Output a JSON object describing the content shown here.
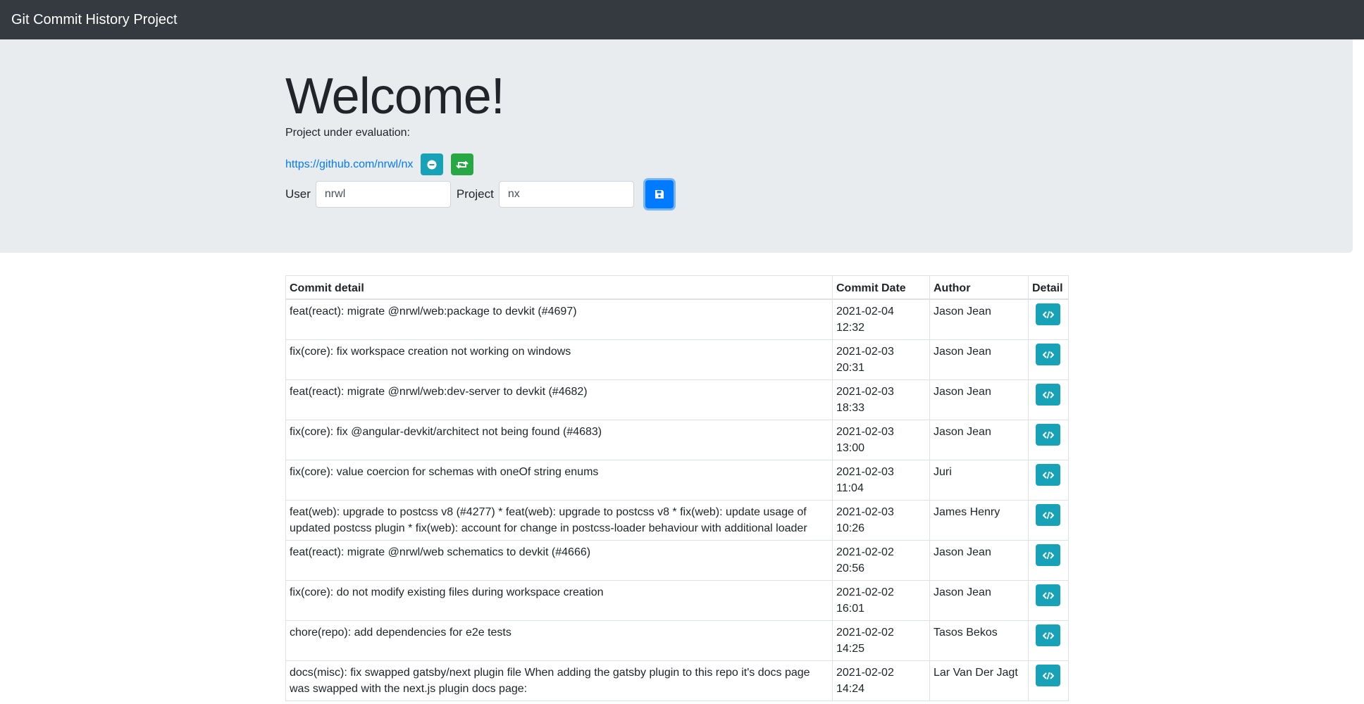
{
  "navbar": {
    "brand": "Git Commit History Project"
  },
  "jumbotron": {
    "title": "Welcome!",
    "eval_label": "Project under evaluation:",
    "repo_link": "https://github.com/nrwl/nx",
    "user_label": "User",
    "user_value": "nrwl",
    "project_label": "Project",
    "project_value": "nx"
  },
  "table": {
    "headers": {
      "detail": "Commit detail",
      "date": "Commit Date",
      "author": "Author",
      "btn": "Detail"
    },
    "rows": [
      {
        "detail": "feat(react): migrate @nrwl/web:package to devkit (#4697)",
        "date1": "2021-02-04",
        "date2": "12:32",
        "author": "Jason Jean"
      },
      {
        "detail": "fix(core): fix workspace creation not working on windows",
        "date1": "2021-02-03",
        "date2": "20:31",
        "author": "Jason Jean"
      },
      {
        "detail": "feat(react): migrate @nrwl/web:dev-server to devkit (#4682)",
        "date1": "2021-02-03",
        "date2": "18:33",
        "author": "Jason Jean"
      },
      {
        "detail": "fix(core): fix @angular-devkit/architect not being found (#4683)",
        "date1": "2021-02-03",
        "date2": "13:00",
        "author": "Jason Jean"
      },
      {
        "detail": "fix(core): value coercion for schemas with oneOf string enums",
        "date1": "2021-02-03",
        "date2": "11:04",
        "author": "Juri"
      },
      {
        "detail": "feat(web): upgrade to postcss v8 (#4277) * feat(web): upgrade to postcss v8 * fix(web): update usage of updated postcss plugin * fix(web): account for change in postcss-loader behaviour with additional loader",
        "date1": "2021-02-03",
        "date2": "10:26",
        "author": "James Henry"
      },
      {
        "detail": "feat(react): migrate @nrwl/web schematics to devkit (#4666)",
        "date1": "2021-02-02",
        "date2": "20:56",
        "author": "Jason Jean"
      },
      {
        "detail": "fix(core): do not modify existing files during workspace creation",
        "date1": "2021-02-02",
        "date2": "16:01",
        "author": "Jason Jean"
      },
      {
        "detail": "chore(repo): add dependencies for e2e tests",
        "date1": "2021-02-02",
        "date2": "14:25",
        "author": "Tasos Bekos"
      },
      {
        "detail": "docs(misc): fix swapped gatsby/next plugin file When adding the gatsby plugin to this repo it's docs page was swapped with the next.js plugin docs page:",
        "date1": "2021-02-02",
        "date2": "14:24",
        "author": "Lar Van Der Jagt"
      }
    ]
  },
  "colors": {
    "navbar": "#343a40",
    "jumbotron": "#e9ecef",
    "info": "#17a2b8",
    "success": "#28a745",
    "primary": "#007bff"
  },
  "icons": {
    "remove": "minus-circle-icon",
    "retweet": "retweet-icon",
    "save": "save-icon",
    "code": "code-icon"
  }
}
